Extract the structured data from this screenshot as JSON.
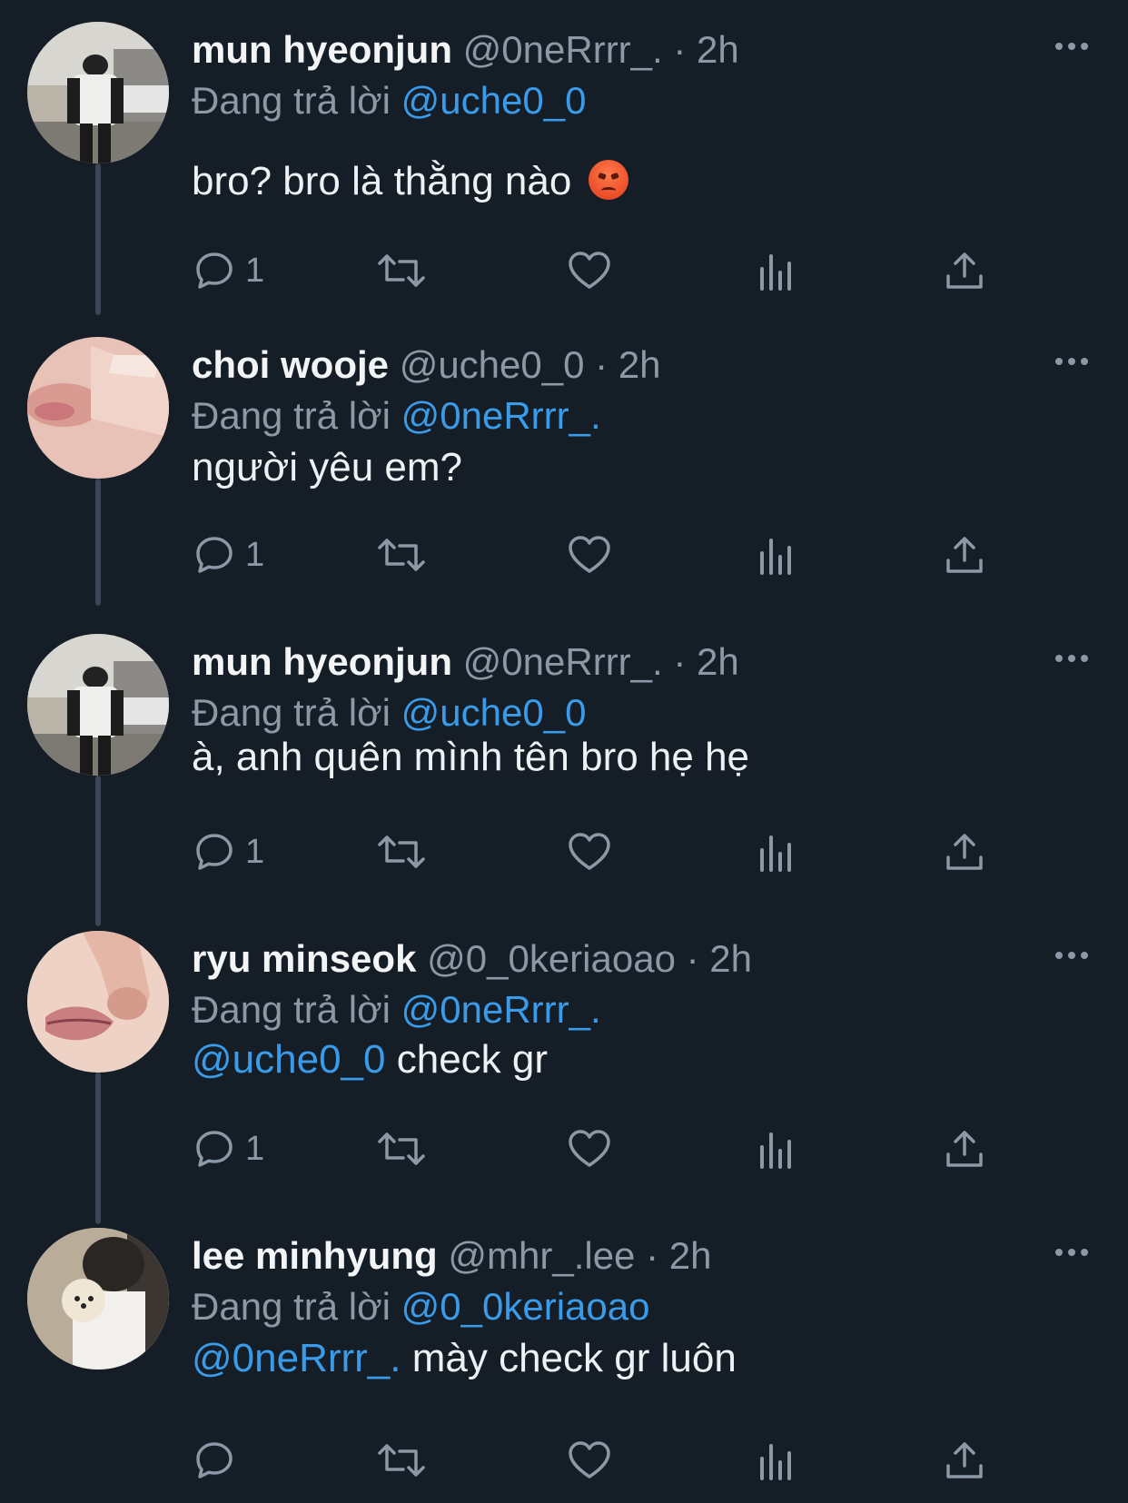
{
  "tweets": [
    {
      "name": "mun hyeonjun",
      "handle": "@0neRrrr_.",
      "dot": "·",
      "time": "2h",
      "replying_prefix": "Đang trả lời ",
      "replying_to": "@uche0_0",
      "body_mention": "",
      "body_text": "bro? bro là thằng nào",
      "emoji": "angry-face-emoji",
      "reply_count": "1",
      "avatar": "avatar-mun-hyeonjun"
    },
    {
      "name": "choi wooje",
      "handle": "@uche0_0",
      "dot": "·",
      "time": "2h",
      "replying_prefix": "Đang trả lời ",
      "replying_to": "@0neRrrr_.",
      "body_mention": "",
      "body_text": "người yêu em?",
      "reply_count": "1",
      "avatar": "avatar-choi-wooje"
    },
    {
      "name": "mun hyeonjun",
      "handle": "@0neRrrr_.",
      "dot": "·",
      "time": "2h",
      "replying_prefix": "Đang trả lời ",
      "replying_to": "@uche0_0",
      "body_mention": "",
      "body_text": "à, anh quên mình tên bro hẹ hẹ",
      "reply_count": "1",
      "avatar": "avatar-mun-hyeonjun"
    },
    {
      "name": "ryu minseok",
      "handle": "@0_0keriaoao",
      "dot": "·",
      "time": "2h",
      "replying_prefix": "Đang trả lời ",
      "replying_to": "@0neRrrr_.",
      "body_mention": "@uche0_0",
      "body_text": " check gr",
      "reply_count": "1",
      "avatar": "avatar-ryu-minseok"
    },
    {
      "name": "lee minhyung",
      "handle": "@mhr_.lee",
      "dot": "·",
      "time": "2h",
      "replying_prefix": "Đang trả lời ",
      "replying_to": "@0_0keriaoao",
      "body_mention": "@0neRrrr_.",
      "body_text": " mày check gr luôn",
      "reply_count": "",
      "avatar": "avatar-lee-minhyung"
    }
  ],
  "colors": {
    "background": "#151d27",
    "mention": "#3a9be8",
    "muted": "#8b98a5",
    "thread_line": "#3a4653"
  },
  "icons": [
    "reply-icon",
    "retweet-icon",
    "like-icon",
    "views-icon",
    "share-icon",
    "more-icon"
  ]
}
